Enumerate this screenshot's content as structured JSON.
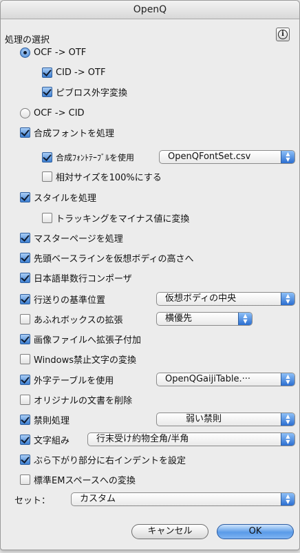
{
  "window": {
    "title": "OpenQ"
  },
  "section": {
    "label": "処理の選択"
  },
  "options": {
    "ocf_to_otf": {
      "label": "OCF -> OTF",
      "selected": true
    },
    "cid_to_otf": {
      "label": "CID -> OTF",
      "checked": true
    },
    "pictos_gaiji": {
      "label": "ピブロス外字変換",
      "checked": true
    },
    "ocf_to_cid": {
      "label": "OCF -> CID",
      "selected": false
    },
    "composite_font": {
      "label": "合成フォントを処理",
      "checked": true
    },
    "use_composite_table": {
      "label": "合成ﾌｫﾝﾄﾃｰﾌﾞﾙを使用",
      "checked": true,
      "popup": "OpenQFontSet.csv"
    },
    "relative_size_100": {
      "label": "相対サイズを100%にする",
      "checked": false
    },
    "style_process": {
      "label": "スタイルを処理",
      "checked": true
    },
    "tracking_negative": {
      "label": "トラッキングをマイナス値に変換",
      "checked": false
    },
    "master_page": {
      "label": "マスターページを処理",
      "checked": true
    },
    "first_baseline": {
      "label": "先頭ベースラインを仮想ボディの高さへ",
      "checked": true
    },
    "japanese_composer": {
      "label": "日本語単数行コンポーザ",
      "checked": true
    },
    "leading_base": {
      "label": "行送りの基準位置",
      "checked": true,
      "popup": "仮想ボディの中央"
    },
    "overflow_box": {
      "label": "あふれボックスの拡張",
      "checked": false,
      "popup": "横優先"
    },
    "image_extension": {
      "label": "画像ファイルへ拡張子付加",
      "checked": true
    },
    "windows_forbidden": {
      "label": "Windows禁止文字の変換",
      "checked": false
    },
    "gaiji_table": {
      "label": "外字テーブルを使用",
      "checked": true,
      "popup": "OpenQGaijiTable.···"
    },
    "delete_original": {
      "label": "オリジナルの文書を削除",
      "checked": false
    },
    "kinsoku": {
      "label": "禁則処理",
      "checked": true,
      "popup": "弱い禁則"
    },
    "mojigumi": {
      "label": "文字組み",
      "checked": true,
      "popup": "行末受け約物全角/半角"
    },
    "hanging_indent": {
      "label": "ぶら下がり部分に右インデントを設定",
      "checked": true
    },
    "em_space": {
      "label": "標準EMスペースへの変換",
      "checked": false
    }
  },
  "set": {
    "label": "セット：",
    "popup": "カスタム"
  },
  "buttons": {
    "cancel": "キャンセル",
    "ok": "OK"
  },
  "colors": {
    "accent": "#3d7fd1",
    "window_bg": "#ececec"
  }
}
